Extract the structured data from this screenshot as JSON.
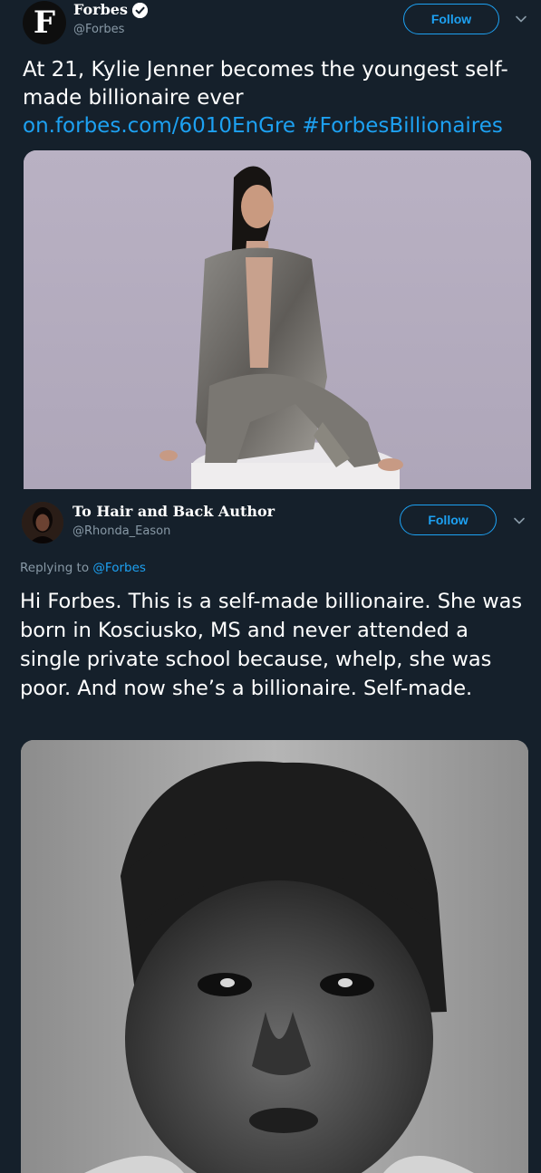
{
  "tweet1": {
    "avatar_letter": "F",
    "display_name": "Forbes",
    "handle": "@Forbes",
    "verified": true,
    "follow_label": "Follow",
    "text_main": "At 21, Kylie Jenner becomes the youngest self-made billionaire ever",
    "link_url": "on.forbes.com/6010EnGre",
    "hashtag": "#ForbesBillionaires",
    "menu_icon": "chevron-down-icon"
  },
  "tweet2": {
    "display_name": "To Hair and Back Author",
    "handle": "@Rhonda_Eason",
    "follow_label": "Follow",
    "replying_prefix": "Replying to",
    "replying_to": "@Forbes",
    "text": "Hi Forbes. This is a self-made billionaire. She was born in Kosciusko, MS and never attended a single private school because, whelp, she was poor. And now she’s a billionaire. Self-made.",
    "menu_icon": "chevron-down-icon"
  },
  "colors": {
    "background": "#15202b",
    "accent": "#1da1f2",
    "secondary_text": "#8899a6",
    "primary_text": "#ffffff"
  }
}
